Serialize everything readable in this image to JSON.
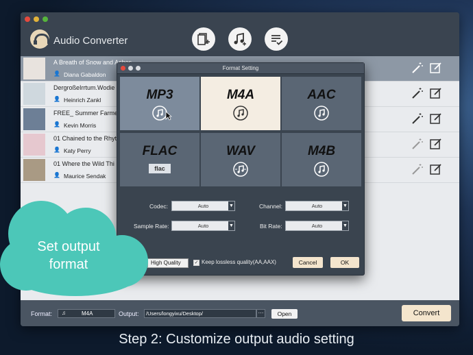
{
  "app": {
    "title": "Audio Converter"
  },
  "tracks": [
    {
      "title": "A Breath of Snow and Ashes",
      "author": "Diana Gabaldon",
      "selected": true
    },
    {
      "title": "DergroßeIrrtum.Wodie",
      "author": "Heinrich Zankl",
      "selected": false
    },
    {
      "title": "FREE_ Summer Farmer",
      "author": "Kevin Morris",
      "selected": false
    },
    {
      "title": "01 Chained to the Rhyt",
      "author": "Katy Perry",
      "selected": false
    },
    {
      "title": "01 Where the Wild Thi",
      "author": "Maurice Sendak",
      "selected": false
    }
  ],
  "dialog": {
    "title": "Format Setting",
    "formats": [
      {
        "name": "MP3",
        "state": "selected"
      },
      {
        "name": "M4A",
        "state": "highlighted"
      },
      {
        "name": "AAC",
        "state": "normal"
      },
      {
        "name": "FLAC",
        "state": "normal",
        "icon_text": "flac"
      },
      {
        "name": "WAV",
        "state": "normal"
      },
      {
        "name": "M4B",
        "state": "normal"
      }
    ],
    "codec_label": "Codec:",
    "codec_value": "Auto",
    "channel_label": "Channel:",
    "channel_value": "Auto",
    "sample_rate_label": "Sample Rate:",
    "sample_rate_value": "Auto",
    "bit_rate_label": "Bit Rate:",
    "bit_rate_value": "Auto",
    "quality_value": "High Quality",
    "keep_lossless_label": "Keep lossless quality(AA,AAX)",
    "cancel_label": "Cancel",
    "ok_label": "OK"
  },
  "bottom": {
    "format_label": "Format:",
    "format_value": "M4A",
    "output_label": "Output:",
    "output_path": "/Users/longyixu/Desktop/",
    "ellipsis": "···",
    "open_label": "Open",
    "convert_label": "Convert"
  },
  "overlay": {
    "cloud_line1": "Set output",
    "cloud_line2": "format",
    "step_caption": "Step 2: Customize output audio setting"
  },
  "colors": {
    "accent": "#f4e5cd",
    "cloud": "#4cc7b8",
    "selected_row": "#8d98a5"
  }
}
